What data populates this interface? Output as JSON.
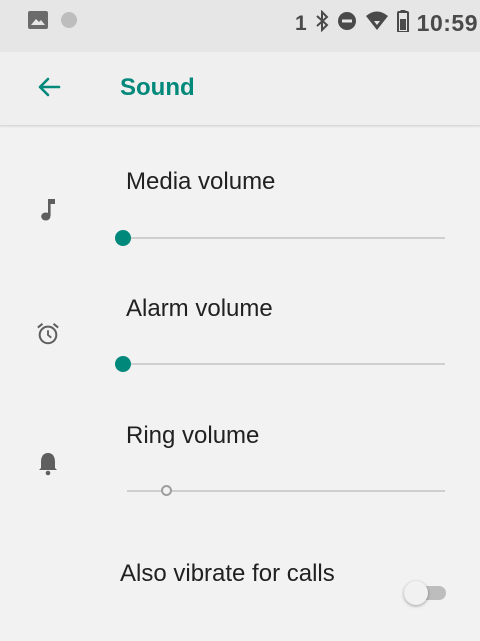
{
  "status_bar": {
    "notification_count": "1",
    "time": "10:59",
    "icons": [
      "image-icon",
      "dot-icon",
      "bluetooth-icon",
      "do-not-disturb-icon",
      "wifi-icon",
      "battery-icon"
    ]
  },
  "app_bar": {
    "title": "Sound",
    "back_icon": "arrow-back-icon"
  },
  "settings": {
    "media": {
      "label": "Media volume",
      "icon": "music-note-icon",
      "level": 0
    },
    "alarm": {
      "label": "Alarm volume",
      "icon": "alarm-icon",
      "level": 0
    },
    "ring": {
      "label": "Ring volume",
      "icon": "bell-icon",
      "level": 0,
      "disabled": true
    },
    "vibrate": {
      "label": "Also vibrate for calls",
      "enabled": false
    }
  },
  "colors": {
    "accent": "#00897b",
    "status_bar_bg": "#e6e6e6",
    "background": "#f2f2f2"
  }
}
